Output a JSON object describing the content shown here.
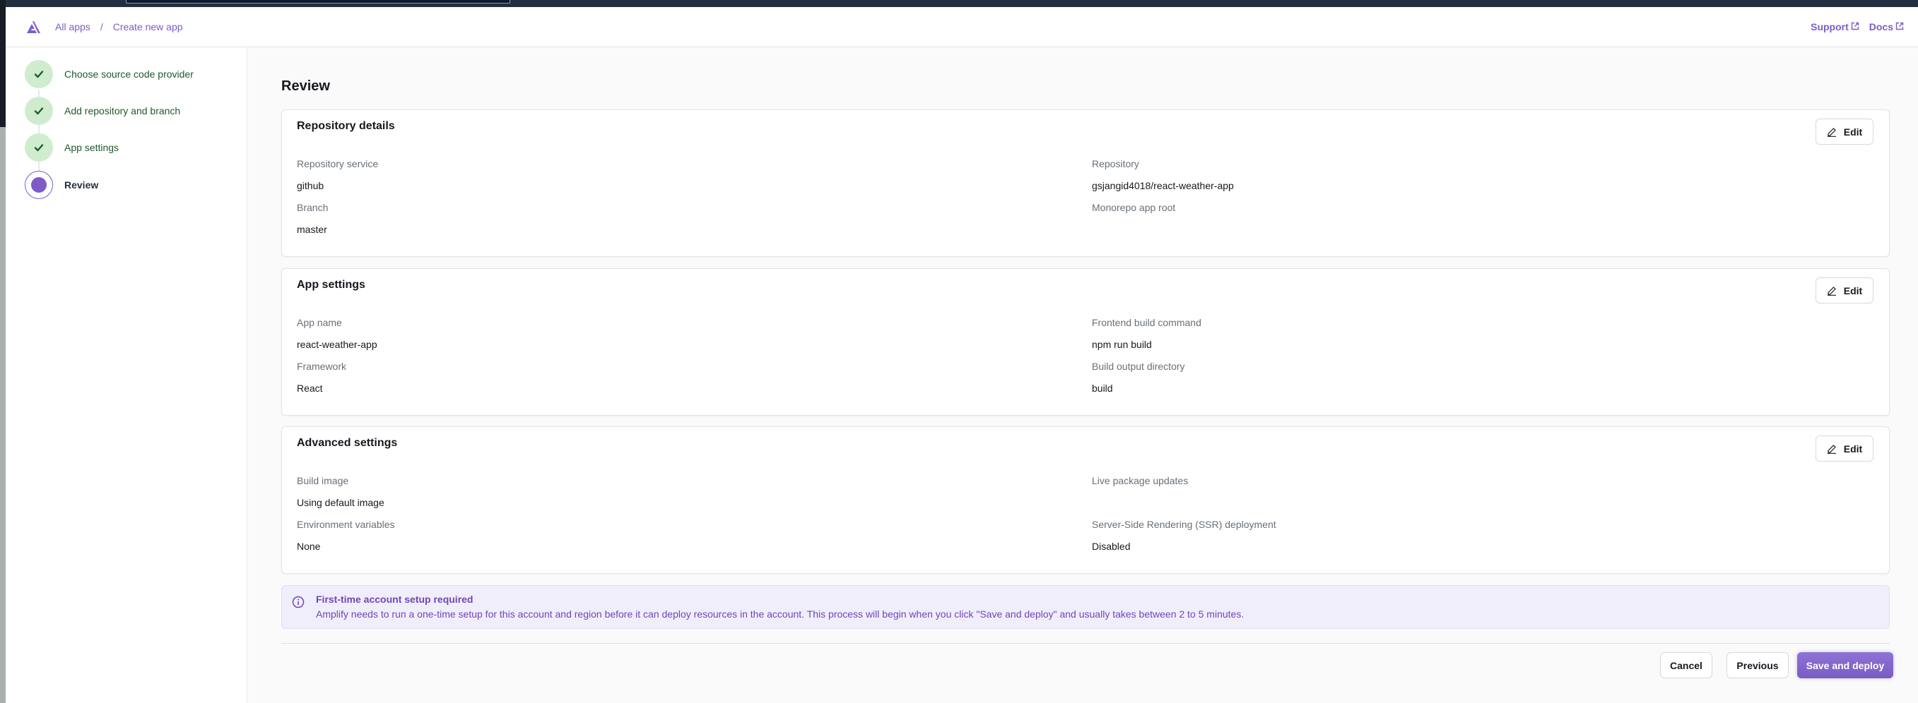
{
  "header": {
    "logo_icon": "amplify-logo-icon",
    "breadcrumb": [
      {
        "label": "All apps"
      },
      {
        "label": "Create new app"
      }
    ],
    "separator": "/",
    "links": [
      {
        "label": "Support",
        "icon": "external-link-icon"
      },
      {
        "label": "Docs",
        "icon": "external-link-icon"
      }
    ]
  },
  "steps": [
    {
      "label": "Choose source code provider",
      "status": "complete"
    },
    {
      "label": "Add repository and branch",
      "status": "complete"
    },
    {
      "label": "App settings",
      "status": "complete"
    },
    {
      "label": "Review",
      "status": "current"
    }
  ],
  "page": {
    "title": "Review"
  },
  "sections": [
    {
      "title": "Repository details",
      "edit_label": "Edit",
      "left": [
        {
          "label": "Repository service",
          "value": "github"
        },
        {
          "label": "Branch",
          "value": "master"
        }
      ],
      "right": [
        {
          "label": "Repository",
          "value": "gsjangid4018/react-weather-app"
        },
        {
          "label": "Monorepo app root",
          "value": ""
        }
      ]
    },
    {
      "title": "App settings",
      "edit_label": "Edit",
      "left": [
        {
          "label": "App name",
          "value": "react-weather-app"
        },
        {
          "label": "Framework",
          "value": "React"
        }
      ],
      "right": [
        {
          "label": "Frontend build command",
          "value": "npm run build"
        },
        {
          "label": "Build output directory",
          "value": "build"
        }
      ]
    },
    {
      "title": "Advanced settings",
      "edit_label": "Edit",
      "left": [
        {
          "label": "Build image",
          "value": "Using default image"
        },
        {
          "label": "Environment variables",
          "value": "None"
        }
      ],
      "right": [
        {
          "label": "Live package updates",
          "value": ""
        },
        {
          "label": "Server-Side Rendering (SSR) deployment",
          "value": "Disabled"
        }
      ]
    }
  ],
  "alert": {
    "icon": "info-icon",
    "title": "First-time account setup required",
    "body": "Amplify needs to run a one-time setup for this account and region before it can deploy resources in the account. This process will begin when you click \"Save and deploy\" and usually takes between 2 to 5 minutes."
  },
  "footer": {
    "cancel_label": "Cancel",
    "previous_label": "Previous",
    "save_label": "Save and deploy"
  },
  "colors": {
    "accent": "#7d5cc7",
    "step_complete_bg": "#cfeccf",
    "step_complete_text": "#1d5a2b",
    "alert_bg": "#f1eefc"
  }
}
